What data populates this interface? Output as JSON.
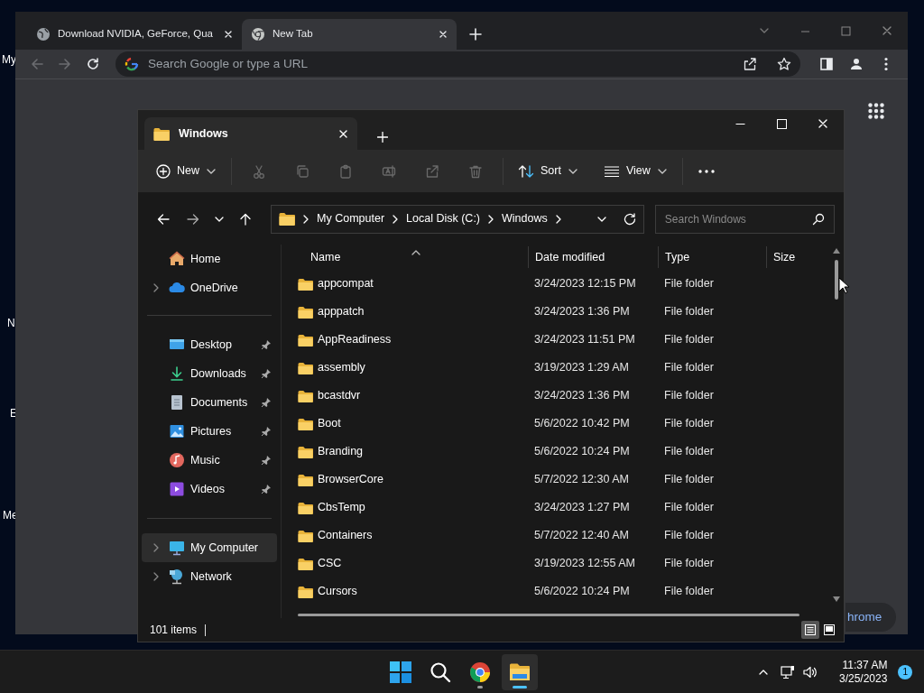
{
  "desktop": {
    "icon_labels": [
      "My",
      "N",
      "E",
      "Me"
    ]
  },
  "browser": {
    "tabs": [
      {
        "kind": "web",
        "title": "Download NVIDIA, GeForce, Qua",
        "selected": false
      },
      {
        "kind": "newtab",
        "title": "New Tab",
        "selected": true
      }
    ],
    "omnibox": {
      "placeholder": "Search Google or type a URL"
    },
    "customize_button": "hrome"
  },
  "explorer": {
    "tab_title": "Windows",
    "new_button": "New",
    "actions": [
      {
        "kind": "cut",
        "disabled": true
      },
      {
        "kind": "copy",
        "disabled": true
      },
      {
        "kind": "paste",
        "disabled": true
      },
      {
        "kind": "rename",
        "disabled": true
      },
      {
        "kind": "share",
        "disabled": true
      },
      {
        "kind": "delete",
        "disabled": true
      }
    ],
    "sort_button": "Sort",
    "view_button": "View",
    "breadcrumb": [
      "My Computer",
      "Local Disk (C:)",
      "Windows"
    ],
    "search": {
      "placeholder": "Search Windows"
    },
    "sidebar": [
      [
        {
          "kind": "home",
          "label": "Home",
          "expandable": false,
          "pinned": false,
          "selected": false
        },
        {
          "kind": "cloud",
          "label": "OneDrive",
          "expandable": true,
          "pinned": false,
          "selected": false
        }
      ],
      [
        {
          "kind": "desktop",
          "label": "Desktop",
          "expandable": false,
          "pinned": true,
          "selected": false
        },
        {
          "kind": "download",
          "label": "Downloads",
          "expandable": false,
          "pinned": true,
          "selected": false
        },
        {
          "kind": "document",
          "label": "Documents",
          "expandable": false,
          "pinned": true,
          "selected": false
        },
        {
          "kind": "picture",
          "label": "Pictures",
          "expandable": false,
          "pinned": true,
          "selected": false
        },
        {
          "kind": "music",
          "label": "Music",
          "expandable": false,
          "pinned": true,
          "selected": false
        },
        {
          "kind": "video",
          "label": "Videos",
          "expandable": false,
          "pinned": true,
          "selected": false
        }
      ],
      [
        {
          "kind": "computer",
          "label": "My Computer",
          "expandable": true,
          "pinned": false,
          "selected": true
        },
        {
          "kind": "network",
          "label": "Network",
          "expandable": true,
          "pinned": false,
          "selected": false
        }
      ]
    ],
    "columns": [
      {
        "label": "Name",
        "sorted": true
      },
      {
        "label": "Date modified",
        "sorted": false
      },
      {
        "label": "Type",
        "sorted": false
      },
      {
        "label": "Size",
        "sorted": false
      }
    ],
    "rows": [
      {
        "name": "appcompat",
        "date": "3/24/2023 12:15 PM",
        "type": "File folder"
      },
      {
        "name": "apppatch",
        "date": "3/24/2023 1:36 PM",
        "type": "File folder"
      },
      {
        "name": "AppReadiness",
        "date": "3/24/2023 11:51 PM",
        "type": "File folder"
      },
      {
        "name": "assembly",
        "date": "3/19/2023 1:29 AM",
        "type": "File folder"
      },
      {
        "name": "bcastdvr",
        "date": "3/24/2023 1:36 PM",
        "type": "File folder"
      },
      {
        "name": "Boot",
        "date": "5/6/2022 10:42 PM",
        "type": "File folder"
      },
      {
        "name": "Branding",
        "date": "5/6/2022 10:24 PM",
        "type": "File folder"
      },
      {
        "name": "BrowserCore",
        "date": "5/7/2022 12:30 AM",
        "type": "File folder"
      },
      {
        "name": "CbsTemp",
        "date": "3/24/2023 1:27 PM",
        "type": "File folder"
      },
      {
        "name": "Containers",
        "date": "5/7/2022 12:40 AM",
        "type": "File folder"
      },
      {
        "name": "CSC",
        "date": "3/19/2023 12:55 AM",
        "type": "File folder"
      },
      {
        "name": "Cursors",
        "date": "5/6/2022 10:24 PM",
        "type": "File folder"
      }
    ],
    "status": "101 items",
    "views": [
      {
        "kind": "details",
        "selected": true
      },
      {
        "kind": "tiles",
        "selected": false
      }
    ]
  },
  "taskbar": {
    "apps": [
      {
        "kind": "start",
        "running": false,
        "active": false
      },
      {
        "kind": "search",
        "running": false,
        "active": false
      },
      {
        "kind": "chrome",
        "running": true,
        "active": false
      },
      {
        "kind": "explorer",
        "running": true,
        "active": true
      }
    ],
    "time": "11:37 AM",
    "date": "3/25/2023",
    "notifications": "1"
  }
}
